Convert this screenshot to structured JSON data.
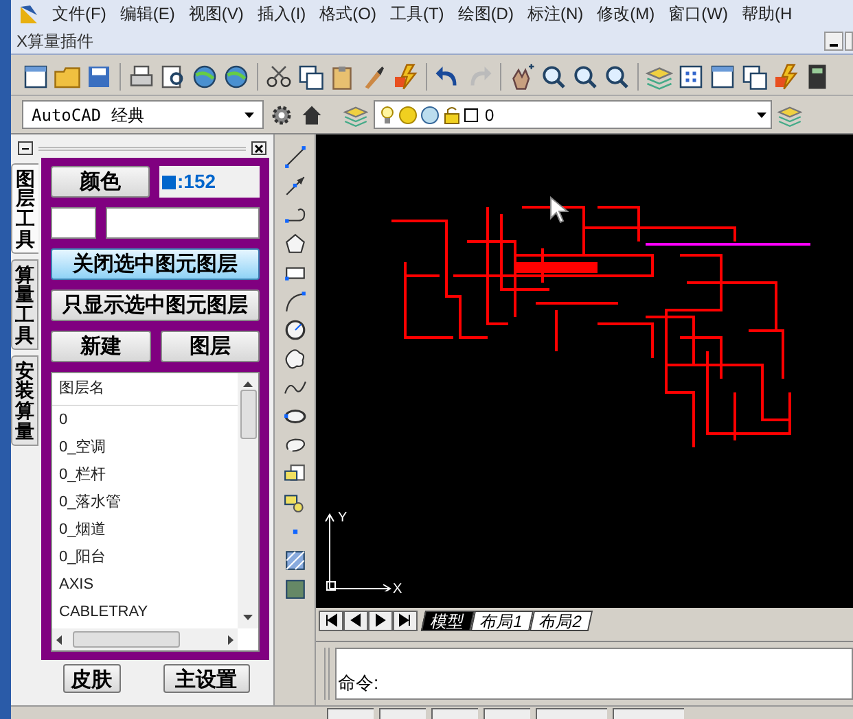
{
  "menu_bar": {
    "items": [
      "文件(F)",
      "编辑(E)",
      "视图(V)",
      "插入(I)",
      "格式(O)",
      "工具(T)",
      "绘图(D)",
      "标注(N)",
      "修改(M)",
      "窗口(W)",
      "帮助(H"
    ]
  },
  "document_title": "X算量插件",
  "workspace_combo": {
    "value": "AutoCAD 经典"
  },
  "layer_combo": {
    "value": "0"
  },
  "palette": {
    "tabs": [
      {
        "label": "图层工具",
        "selected": true
      },
      {
        "label": "算量工具",
        "selected": false
      },
      {
        "label": "安装算量",
        "selected": false
      }
    ],
    "color_button": "颜色",
    "color_value": ":152",
    "buttons": [
      {
        "label": "关闭选中图元图层",
        "highlighted": true
      },
      {
        "label": "只显示选中图元图层",
        "highlighted": false
      }
    ],
    "small_buttons": [
      "新建",
      "图层"
    ],
    "layer_list": {
      "header": "图层名",
      "items": [
        "0",
        "0_空调",
        "0_栏杆",
        "0_落水管",
        "0_烟道",
        "0_阳台",
        "AXIS",
        "CABLETRAY"
      ]
    },
    "footer_buttons": [
      "皮肤",
      "主设置"
    ]
  },
  "canvas": {
    "axis_x": "X",
    "axis_y": "Y"
  },
  "layout_tabs": [
    {
      "label": "模型",
      "selected": true
    },
    {
      "label": "布局1",
      "selected": false
    },
    {
      "label": "布局2",
      "selected": false
    }
  ],
  "command_line": {
    "prompt": "命令:"
  }
}
